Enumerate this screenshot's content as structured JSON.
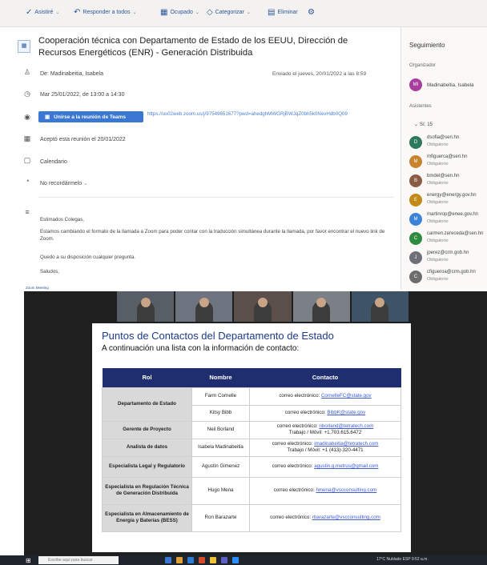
{
  "toolbar": {
    "reply_all": "Asistiré",
    "respond": "Responder a todos",
    "onboarding": "Ocupado",
    "categorize": "Categorizar",
    "delete": "Eliminar"
  },
  "meeting": {
    "subject": "Cooperación técnica con Departamento de Estado de los EEUU, Dirección de Recursos Energéticos (ENR) - Generación Distribuida",
    "from": "De: Madinabeitia, Isabela",
    "sent": "Enviado el jueves, 20/01/2022 a las 8:59",
    "when": "Mar 25/01/2022, de 13:00 a 14:30",
    "teams_button": "Unirse a la reunión de Teams",
    "teams_link": "https://us02web.zoom.us/j/97549651677?pwd=ahedghMWGRjBWJqZ0bh5k0NevHdb0Q09",
    "accepted": "Aceptó esta reunión el 20/01/2022",
    "calendar": "Calendario",
    "reminder": "No recordármelo",
    "body": {
      "greeting": "Estimados Colegas,",
      "p1": "Estamos cambiando el formato de la llamada a Zoom para poder contar con la traducción simultánea durante la llamada, por favor encontrar el nuevo link de Zoom.",
      "p2": "Quedo a su disposición cualquier pregunta.",
      "closing": "Saludos,"
    }
  },
  "sidebar": {
    "title": "Seguimiento",
    "organizer_label": "Organizador",
    "organizer_initials": "MI",
    "organizer_name": "Madinabeitia, Isabela",
    "attendees_label": "Asistentes",
    "yes_group": "Sí: 15",
    "attendees": [
      {
        "initials": "D",
        "email": "dsofia@sen.hn",
        "status": "Obligatorio",
        "color": "#2c7a5b"
      },
      {
        "initials": "M",
        "email": "mfiguerca@sen.hn",
        "status": "Obligatorio",
        "color": "#c7832e"
      },
      {
        "initials": "B",
        "email": "bmdel@sen.hn",
        "status": "Obligatorio",
        "color": "#8a5c46"
      },
      {
        "initials": "E",
        "email": "energy@energy.gov.hn",
        "status": "Obligatorio",
        "color": "#c28a17"
      },
      {
        "initials": "M",
        "email": "martinrop@enee.gov.hn",
        "status": "Obligatorio",
        "color": "#3a83d8"
      },
      {
        "initials": "C",
        "email": "carmen.zereceda@sen.hn",
        "status": "Obligatorio",
        "color": "#2e8a3e"
      },
      {
        "initials": "J",
        "email": "jperez@crm.gob.hn",
        "status": "Obligatorio",
        "color": "#6f6f7a"
      },
      {
        "initials": "C",
        "email": "cfigueroa@crm.gob.hn",
        "status": "Obligatorio",
        "color": "#6d6d6d"
      }
    ]
  },
  "zoom": {
    "window_label": "Zoom Meeting",
    "slide": {
      "title": "Puntos de Contactos del Departamento de Estado",
      "subtitle": "A continuación una lista con la información de contacto:",
      "headers": [
        "Rol",
        "Nombre",
        "Contacto"
      ],
      "rows": [
        {
          "rol": "Departamento de Estado",
          "nombre": "Farm Cornelle",
          "contacto": "correo electrónico:",
          "link": "CornelleFC@state.gov",
          "extra": ""
        },
        {
          "rol": "",
          "nombre": "Kitsy Bibb",
          "contacto": "correo electrónico:",
          "link": "BibbK@state.gov",
          "extra": ""
        },
        {
          "rol": "Gerente de Proyecto",
          "nombre": "Neil Borland",
          "contacto": "correo electrónico:",
          "link": "nborland@tetratech.com",
          "extra": "Trabajo / Móvil: +1.703.615.6472"
        },
        {
          "rol": "Analista de datos",
          "nombre": "Isabela Madinabeitia",
          "contacto": "correo electrónico:",
          "link": "imadinabeitia@tetratech.com",
          "extra": "Trabajo / Móvil: +1 (413)-320-4471"
        },
        {
          "rol": "Especialista Legal y Regulatorio",
          "nombre": "Agustín Gimenez",
          "contacto": "correo electrónico:",
          "link": "agustin.g.metrus@gmail.com",
          "extra": ""
        },
        {
          "rol": "Especialista en Regulación Técnica de Generación Distribuida",
          "nombre": "Hugo Mena",
          "contacto": "correo electrónico:",
          "link": "hmena@vscconsulting.com",
          "extra": ""
        },
        {
          "rol": "Especialista en Almacenamiento de Energía y Baterías (BESS)",
          "nombre": "Ron Barazarte",
          "contacto": "correo electrónico:",
          "link": "rbarazarte@vscconsulting.com",
          "extra": ""
        }
      ]
    }
  },
  "taskbar": {
    "search_placeholder": "Escribe aquí para buscar",
    "tray": "17°C Nublado  ESP  9:52 a.m."
  },
  "colors": {
    "accent": "#2b579a",
    "teams_button": "#3a78d4",
    "table_header": "#1f2e6e",
    "slide_title": "#1d3a8a"
  }
}
